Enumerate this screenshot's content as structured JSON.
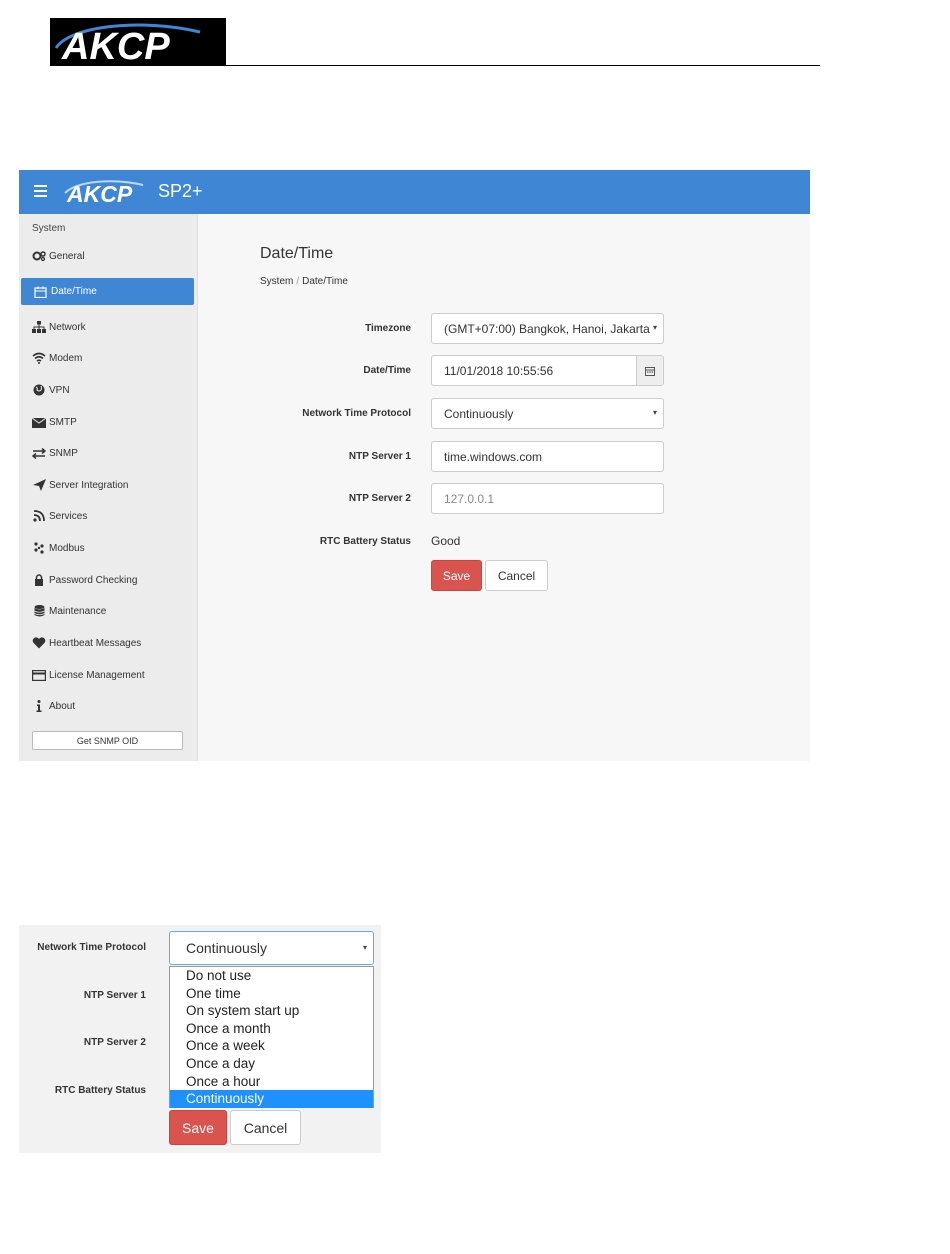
{
  "document": {
    "brand": "AKCP"
  },
  "app": {
    "brand": "AKCP",
    "model": "SP2+"
  },
  "sidebar": {
    "heading": "System",
    "items": [
      {
        "label": "General",
        "icon": "gears-icon"
      },
      {
        "label": "Date/Time",
        "icon": "calendar-icon",
        "active": true
      },
      {
        "label": "Network",
        "icon": "sitemap-icon"
      },
      {
        "label": "Modem",
        "icon": "wifi-icon"
      },
      {
        "label": "VPN",
        "icon": "globe-icon"
      },
      {
        "label": "SMTP",
        "icon": "envelope-icon"
      },
      {
        "label": "SNMP",
        "icon": "exchange-icon"
      },
      {
        "label": "Server Integration",
        "icon": "paper-plane-icon"
      },
      {
        "label": "Services",
        "icon": "rss-icon"
      },
      {
        "label": "Modbus",
        "icon": "modbus-icon"
      },
      {
        "label": "Password Checking",
        "icon": "lock-icon"
      },
      {
        "label": "Maintenance",
        "icon": "database-icon"
      },
      {
        "label": "Heartbeat Messages",
        "icon": "heart-icon"
      },
      {
        "label": "License Management",
        "icon": "credit-card-icon"
      },
      {
        "label": "About",
        "icon": "info-icon"
      }
    ],
    "button_label": "Get SNMP OID"
  },
  "main": {
    "title": "Date/Time",
    "breadcrumb": [
      "System",
      "Date/Time"
    ],
    "form": {
      "timezone": {
        "label": "Timezone",
        "value": "(GMT+07:00) Bangkok, Hanoi, Jakarta"
      },
      "datetime": {
        "label": "Date/Time",
        "value": "11/01/2018 10:55:56"
      },
      "ntp": {
        "label": "Network Time Protocol",
        "value": "Continuously"
      },
      "ntp_server1": {
        "label": "NTP Server 1",
        "value": "time.windows.com"
      },
      "ntp_server2": {
        "label": "NTP Server 2",
        "placeholder": "127.0.0.1"
      },
      "rtc": {
        "label": "RTC Battery Status",
        "value": "Good"
      }
    },
    "save_label": "Save",
    "cancel_label": "Cancel"
  },
  "dropdown_shot": {
    "ntp_label": "Network Time Protocol",
    "ntp_server1_label": "NTP Server 1",
    "ntp_server2_label": "NTP Server 2",
    "rtc_label": "RTC Battery Status",
    "selected": "Continuously",
    "options": [
      "Do not use",
      "One time",
      "On system start up",
      "Once a month",
      "Once a week",
      "Once a day",
      "Once a hour",
      "Continuously"
    ],
    "save_label": "Save",
    "cancel_label": "Cancel"
  },
  "colors": {
    "header_blue": "#3f87d5",
    "save_red": "#d9534f",
    "selected_option": "#1e90ff"
  }
}
